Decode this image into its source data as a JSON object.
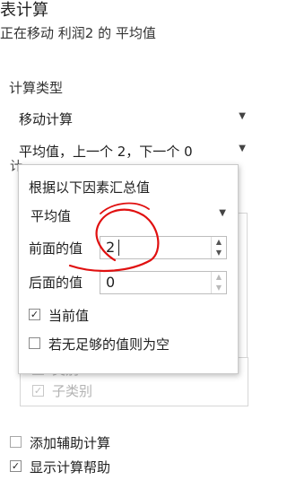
{
  "header": {
    "title": "表计算",
    "subtitle": "正在移动 利润2 的 平均值"
  },
  "calc_type": {
    "label": "计算类型",
    "selected_type": "移动计算",
    "summary": "平均值，上一个 2，下一个 0",
    "partial_label": "计"
  },
  "popup": {
    "heading": "根据以下因素汇总值",
    "aggregation": "平均值",
    "previous_label": "前面的值",
    "previous_value": "2",
    "next_label": "后面的值",
    "next_value": "0",
    "current_value_label": "当前值",
    "current_value_checked": true,
    "null_if_insufficient_label": "若无足够的值则为空",
    "null_if_insufficient_checked": false
  },
  "background_list": {
    "items": [
      "类别",
      "子类别"
    ]
  },
  "footer": {
    "add_secondary_label": "添加辅助计算",
    "add_secondary_checked": false,
    "show_help_label": "显示计算帮助",
    "show_help_checked": true
  },
  "annotation_color": "#e01010"
}
